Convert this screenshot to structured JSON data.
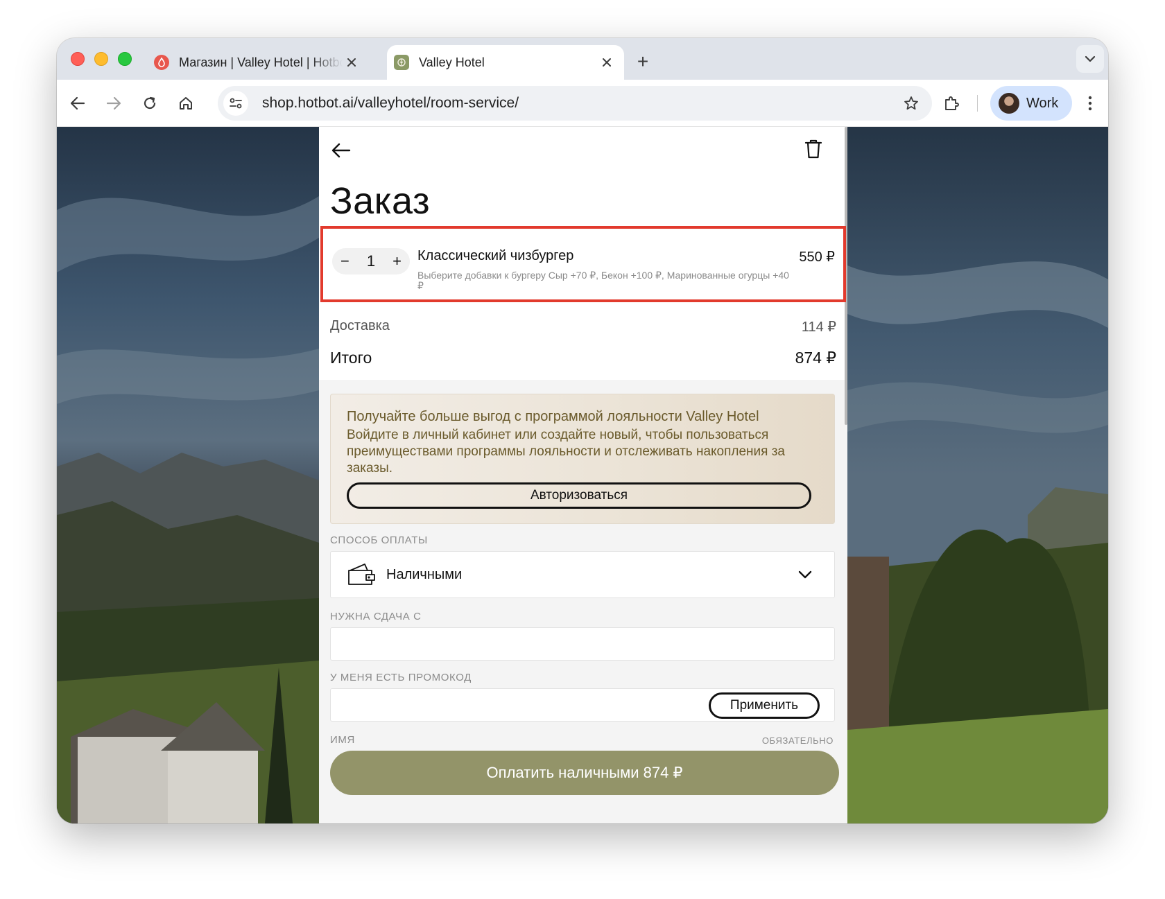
{
  "browser": {
    "tabs": [
      {
        "title": "Магазин | Valley Hotel | Hotbot",
        "active": false
      },
      {
        "title": "Valley Hotel",
        "active": true
      }
    ],
    "new_tab_label": "+",
    "url": "shop.hotbot.ai/valleyhotel/room-service/",
    "profile_name": "Work",
    "accent_color": "#d3e3fd"
  },
  "order": {
    "title": "Заказ",
    "item": {
      "quantity": "1",
      "minus": "−",
      "plus": "+",
      "name": "Классический чизбургер",
      "price": "550 ₽",
      "options": "Выберите добавки к бургеру Сыр +70 ₽,  Бекон +100 ₽,  Маринованные огурцы +40 ₽"
    },
    "delivery_label": "Доставка",
    "delivery_value": "114 ₽",
    "total_label": "Итого",
    "total_value": "874 ₽",
    "highlight_color": "#e23a2d"
  },
  "loyalty": {
    "title": "Получайте больше выгод с программой лояльности Valley Hotel",
    "text": "Войдите в личный кабинет или создайте новый, чтобы пользоваться преимуществами программы лояльности и отслеживать накопления за заказы.",
    "button": "Авторизоваться"
  },
  "payment": {
    "label": "СПОСОБ ОПЛАТЫ",
    "selected": "Наличными",
    "change_label": "НУЖНА СДАЧА С",
    "change_value": "",
    "promo_label": "У МЕНЯ ЕСТЬ ПРОМОКОД",
    "promo_value": "",
    "apply_button": "Применить",
    "name_label": "ИМЯ",
    "required_label": "ОБЯЗАТЕЛЬНО",
    "pay_button": "Оплатить наличными 874 ₽",
    "pay_color": "#939469"
  },
  "icons": [
    "back-arrow-icon",
    "forward-arrow-icon",
    "reload-icon",
    "home-icon",
    "site-settings-icon",
    "star-icon",
    "extensions-icon",
    "kebab-menu-icon",
    "trash-icon",
    "wallet-icon",
    "chevron-down-icon",
    "close-icon"
  ]
}
